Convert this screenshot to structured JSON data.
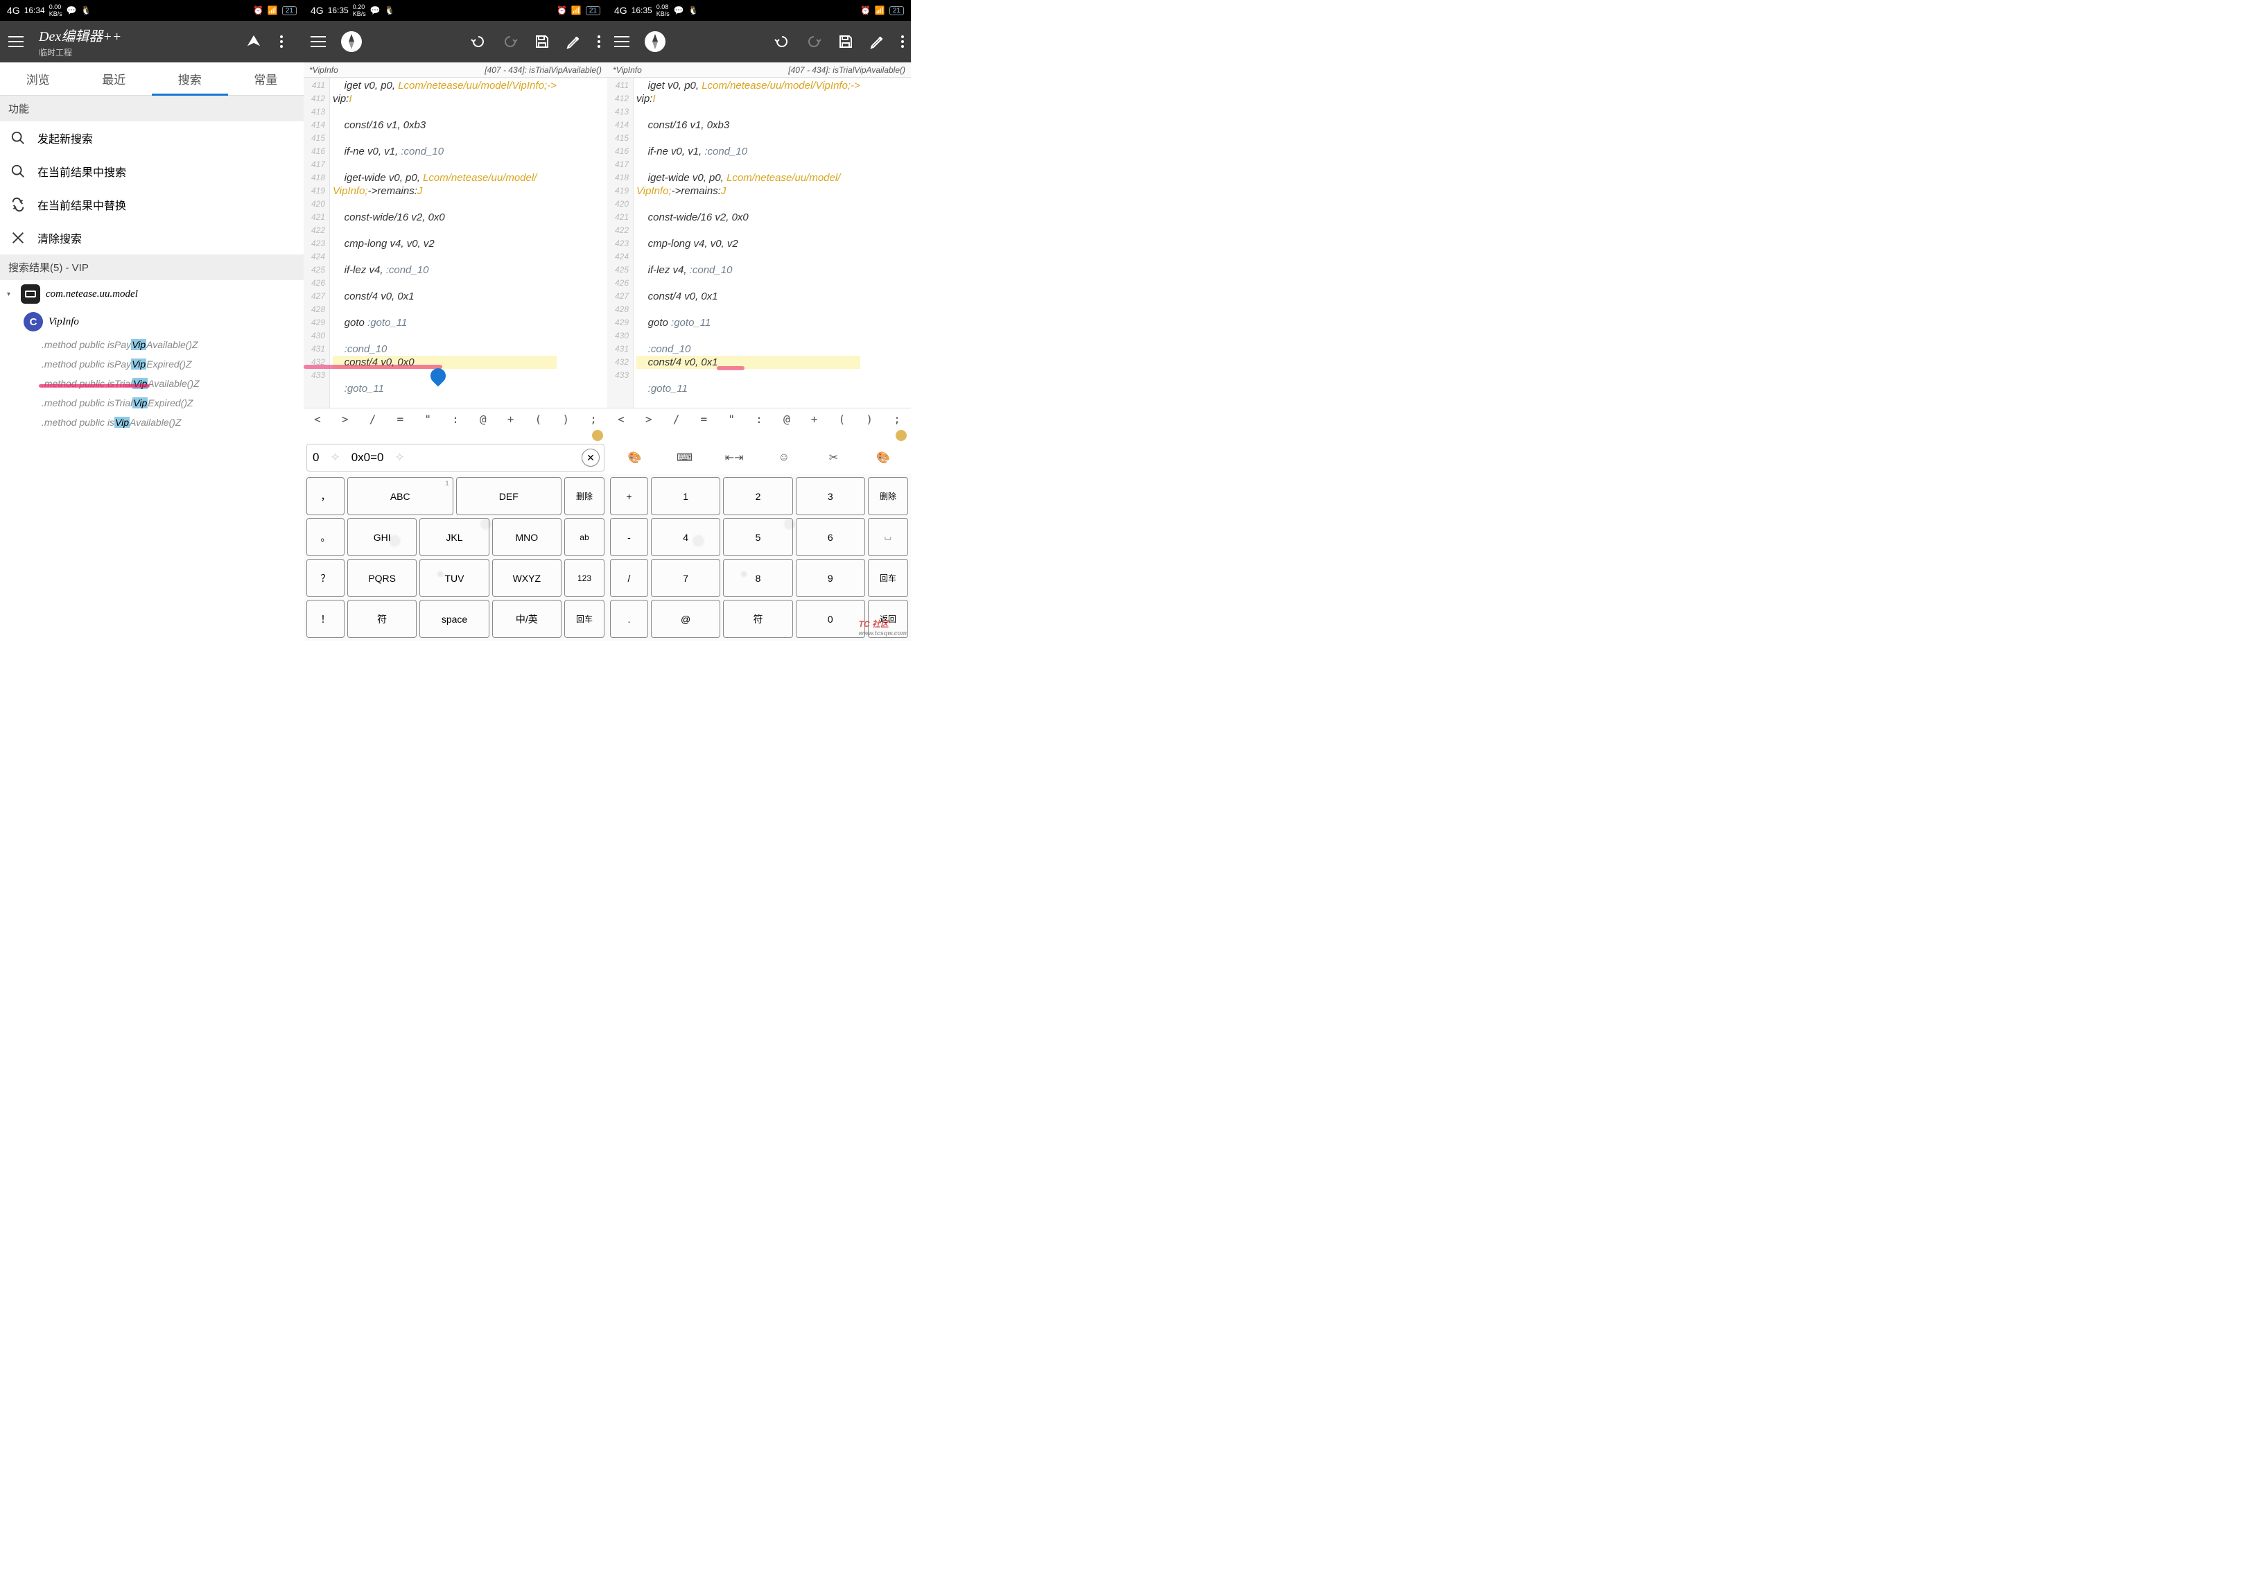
{
  "statusBar": {
    "netType": "4G",
    "time1": "16:34",
    "time2": "16:35",
    "time3": "16:35",
    "speed1": "0.00",
    "speed2": "0.20",
    "speed3": "0.08",
    "speedUnit": "KB/s",
    "battery": "21"
  },
  "appA": {
    "title": "Dex编辑器++",
    "subtitle": "临时工程",
    "tabs": [
      "浏览",
      "最近",
      "搜索",
      "常量"
    ],
    "activeTab": 2,
    "sectionFunc": "功能",
    "actions": {
      "newSearch": "发起新搜索",
      "searchInResults": "在当前结果中搜索",
      "replaceInResults": "在当前结果中替换",
      "clearSearch": "清除搜索"
    },
    "resultsHeader": "搜索结果(5) - VIP",
    "packageName": "com.netease.uu.model",
    "className": "VipInfo",
    "classBadge": "C",
    "methods": [
      {
        "prefix": ".method public isPay",
        "hl": "Vip",
        "suffix": "Available()Z"
      },
      {
        "prefix": ".method public isPay",
        "hl": "Vip",
        "suffix": "Expired()Z"
      },
      {
        "prefix": ".method public isTrial",
        "hl": "Vip",
        "suffix": "Available()Z",
        "circled": true
      },
      {
        "prefix": ".method public isTrial",
        "hl": "Vip",
        "suffix": "Expired()Z"
      },
      {
        "prefix": ".method public is",
        "hl": "Vip",
        "suffix": "Available()Z"
      }
    ]
  },
  "editor": {
    "fileName": "*VipInfo",
    "location": "[407 - 434]: isTrialVipAvailable()",
    "linesB": [
      {
        "n": 411,
        "raw": "    iget v0, p0, ",
        "cls": "Lcom/netease/uu/model/VipInfo;->"
      },
      {
        "n": "",
        "raw": "vip:",
        "tail": "I"
      },
      {
        "n": 412,
        "raw": ""
      },
      {
        "n": 413,
        "raw": "    const/16 v1, 0xb3"
      },
      {
        "n": 414,
        "raw": ""
      },
      {
        "n": 415,
        "raw": "    if-ne v0, v1, ",
        "lbl": ":cond_10"
      },
      {
        "n": 416,
        "raw": ""
      },
      {
        "n": 417,
        "raw": "    iget-wide v0, p0, ",
        "cls": "Lcom/netease/uu/model/"
      },
      {
        "n": "",
        "raw": "",
        "cls": "VipInfo;",
        "raw2": "->remains:",
        "tail": "J"
      },
      {
        "n": 418,
        "raw": ""
      },
      {
        "n": 419,
        "raw": "    const-wide/16 v2, 0x0"
      },
      {
        "n": 420,
        "raw": ""
      },
      {
        "n": 421,
        "raw": "    cmp-long v4, v0, v2"
      },
      {
        "n": 422,
        "raw": ""
      },
      {
        "n": 423,
        "raw": "    if-lez v4, ",
        "lbl": ":cond_10"
      },
      {
        "n": 424,
        "raw": ""
      },
      {
        "n": 425,
        "raw": "    const/4 v0, 0x1"
      },
      {
        "n": 426,
        "raw": ""
      },
      {
        "n": 427,
        "raw": "    goto ",
        "lbl": ":goto_11"
      },
      {
        "n": 428,
        "raw": ""
      },
      {
        "n": 429,
        "raw": "    ",
        "lbl": ":cond_10"
      },
      {
        "n": 430,
        "raw": "    const/4 v0, 0x0",
        "hlLine": true,
        "marker": "full"
      },
      {
        "n": 431,
        "raw": ""
      },
      {
        "n": 432,
        "raw": "    ",
        "lbl": ":goto_11"
      },
      {
        "n": 433,
        "raw": ""
      }
    ],
    "linesC": [
      {
        "n": 411,
        "raw": "    iget v0, p0, ",
        "cls": "Lcom/netease/uu/model/VipInfo;->"
      },
      {
        "n": "",
        "raw": "vip:",
        "tail": "I"
      },
      {
        "n": 412,
        "raw": ""
      },
      {
        "n": 413,
        "raw": "    const/16 v1, 0xb3"
      },
      {
        "n": 414,
        "raw": ""
      },
      {
        "n": 415,
        "raw": "    if-ne v0, v1, ",
        "lbl": ":cond_10"
      },
      {
        "n": 416,
        "raw": ""
      },
      {
        "n": 417,
        "raw": "    iget-wide v0, p0, ",
        "cls": "Lcom/netease/uu/model/"
      },
      {
        "n": "",
        "raw": "",
        "cls": "VipInfo;",
        "raw2": "->remains:",
        "tail": "J"
      },
      {
        "n": 418,
        "raw": ""
      },
      {
        "n": 419,
        "raw": "    const-wide/16 v2, 0x0"
      },
      {
        "n": 420,
        "raw": ""
      },
      {
        "n": 421,
        "raw": "    cmp-long v4, v0, v2"
      },
      {
        "n": 422,
        "raw": ""
      },
      {
        "n": 423,
        "raw": "    if-lez v4, ",
        "lbl": ":cond_10"
      },
      {
        "n": 424,
        "raw": ""
      },
      {
        "n": 425,
        "raw": "    const/4 v0, 0x1"
      },
      {
        "n": 426,
        "raw": ""
      },
      {
        "n": 427,
        "raw": "    goto ",
        "lbl": ":goto_11"
      },
      {
        "n": 428,
        "raw": ""
      },
      {
        "n": 429,
        "raw": "    ",
        "lbl": ":cond_10"
      },
      {
        "n": 430,
        "raw": "    const/4 v0, 0x1",
        "hlLine": true,
        "marker": "end"
      },
      {
        "n": 431,
        "raw": ""
      },
      {
        "n": 432,
        "raw": "    ",
        "lbl": ":goto_11"
      },
      {
        "n": 433,
        "raw": ""
      }
    ]
  },
  "symbols": [
    "<",
    ">",
    "/",
    "=",
    "\"",
    ":",
    "@",
    "+",
    "(",
    ")",
    ";"
  ],
  "imeB": {
    "cand1": "0",
    "cand2": "0x0=0",
    "rows": [
      [
        {
          "t": "，",
          "w": "narrow"
        },
        {
          "t": "ABC",
          "c": "1"
        },
        {
          "t": "DEF",
          "c": ""
        },
        {
          "t": "删除",
          "w": "side"
        }
      ],
      [
        {
          "t": "。",
          "w": "narrow"
        },
        {
          "t": "GHI",
          "c": ""
        },
        {
          "t": "JKL",
          "c": ""
        },
        {
          "t": "MNO",
          "c": ""
        },
        {
          "t": "ab",
          "w": "side"
        }
      ],
      [
        {
          "t": "？",
          "w": "narrow"
        },
        {
          "t": "PQRS",
          "c": ""
        },
        {
          "t": "TUV",
          "c": ""
        },
        {
          "t": "WXYZ",
          "c": ""
        },
        {
          "t": "123",
          "w": "side"
        }
      ],
      [
        {
          "t": "！",
          "w": "narrow"
        },
        {
          "t": "符"
        },
        {
          "t": "space"
        },
        {
          "t": "中/英"
        },
        {
          "t": "回车",
          "w": "side"
        }
      ]
    ],
    "dotsRow": "…"
  },
  "imeC": {
    "rows": [
      [
        {
          "t": "+",
          "w": "narrow"
        },
        {
          "t": "1"
        },
        {
          "t": "2"
        },
        {
          "t": "3"
        },
        {
          "t": "删除",
          "w": "side"
        }
      ],
      [
        {
          "t": "-",
          "w": "narrow"
        },
        {
          "t": "4"
        },
        {
          "t": "5"
        },
        {
          "t": "6"
        },
        {
          "t": "⌴",
          "w": "side"
        }
      ],
      [
        {
          "t": "/",
          "w": "narrow"
        },
        {
          "t": "7"
        },
        {
          "t": "8"
        },
        {
          "t": "9"
        },
        {
          "t": "回车",
          "w": "side"
        }
      ],
      [
        {
          "t": ".",
          "w": "narrow"
        },
        {
          "t": "@"
        },
        {
          "t": "符"
        },
        {
          "t": "0"
        },
        {
          "t": "返回",
          "w": "side"
        }
      ]
    ]
  },
  "watermark": {
    "main": "TC 社区",
    "sub": "www.tcsqw.com"
  }
}
